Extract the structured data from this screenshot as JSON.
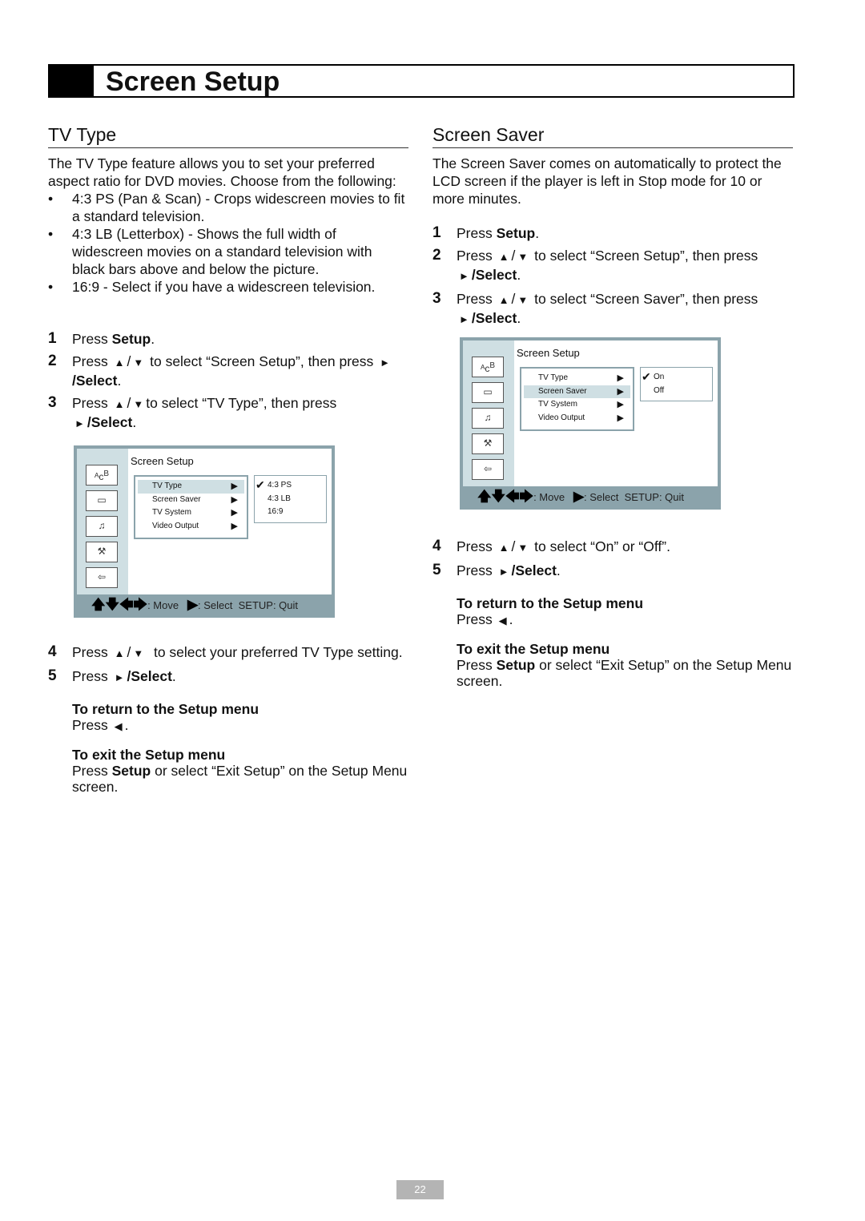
{
  "title": "Screen Setup",
  "page_number": "22",
  "left": {
    "heading": "TV Type",
    "intro": "The TV Type feature allows you to set your preferred aspect ratio for DVD movies. Choose from the following:",
    "bullets": [
      "4:3 PS (Pan & Scan) - Crops widescreen movies to fit a standard television.",
      "4:3 LB (Letterbox) - Shows the full width of widescreen movies on a standard television with black bars above and below the picture.",
      "16:9 - Select if you have a widescreen television."
    ],
    "steps": {
      "s1": "Press ",
      "s1b": "Setup",
      "s2": "Press",
      "s2t": "to select “Screen Setup”, then press",
      "s3": "Press",
      "s3t": "to select “TV Type”, then press",
      "s4": "Press",
      "s4t": "to select your preferred TV Type setting.",
      "s5": "Press",
      "select": "/Select"
    },
    "return_heading": "To return to the Setup menu",
    "return_text": "Press",
    "exit_heading": "To exit the Setup menu",
    "exit_a": "Press ",
    "exit_b": "Setup",
    "exit_c": " or select “Exit Setup” on the Setup Menu screen."
  },
  "right": {
    "heading": "Screen Saver",
    "intro": "The Screen Saver comes on automatically to protect the LCD screen if the player is left in Stop mode for 10 or more minutes.",
    "steps": {
      "s1": "Press ",
      "s1b": "Setup",
      "s2": "Press",
      "s2t": "to select “Screen Setup”, then press",
      "s3": "Press",
      "s3t": "to select “Screen Saver”, then press",
      "s4": "Press",
      "s4t": "to select “On” or “Off”.",
      "s5": "Press",
      "select": "/Select"
    },
    "return_heading": "To return to the Setup menu",
    "return_text": "Press",
    "exit_heading": "To exit the Setup menu",
    "exit_a": "Press ",
    "exit_b": "Setup",
    "exit_c": " or select “Exit Setup” on the Setup Menu screen."
  },
  "menu": {
    "title": "Screen Setup",
    "items": [
      "TV Type",
      "Screen Saver",
      "TV System",
      "Video Output"
    ],
    "footer_move": ": Move",
    "footer_select": ": Select",
    "footer_quit": "SETUP: Quit"
  },
  "menu_left": {
    "selected_item": "TV Type",
    "options": [
      "4:3  PS",
      "4:3  LB",
      "16:9"
    ],
    "checked": "4:3  PS"
  },
  "menu_right": {
    "selected_item": "Screen Saver",
    "options": [
      "On",
      "Off"
    ],
    "checked": "On"
  },
  "colors": {
    "menu_frame": "#8ba3ab",
    "menu_highlight": "#cfdfe3"
  }
}
